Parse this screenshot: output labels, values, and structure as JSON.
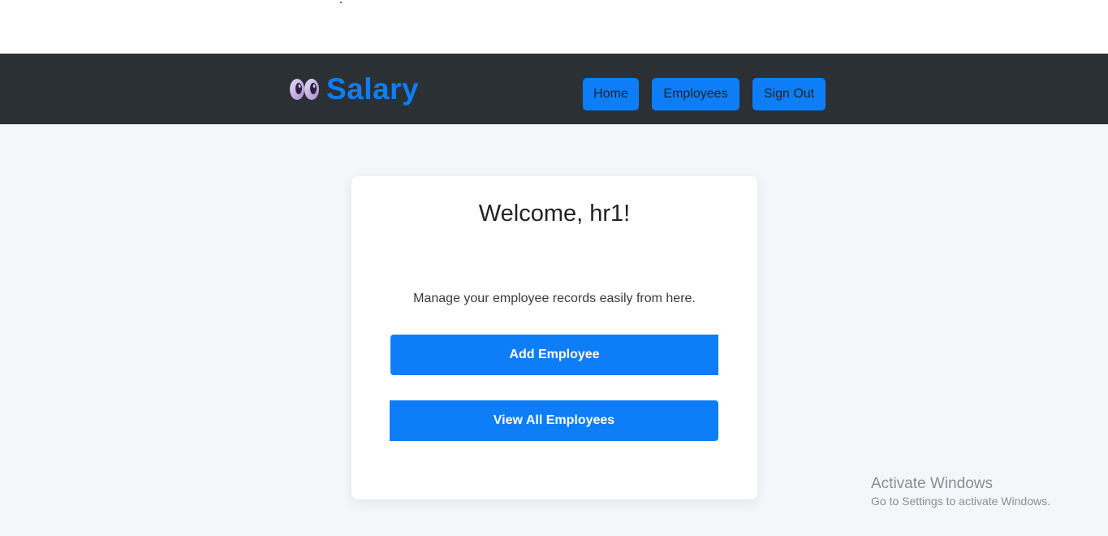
{
  "brand": {
    "name": "Salary",
    "logo_icon": "owl-eyes-icon",
    "color": "#0d7ef7"
  },
  "nav": {
    "home_label": "Home",
    "employees_label": "Employees",
    "signout_label": "Sign Out"
  },
  "card": {
    "welcome": "Welcome, hr1!",
    "subtitle": "Manage your employee records easily from here.",
    "add_label": "Add Employee",
    "view_label": "View All Employees"
  },
  "watermark": {
    "title": "Activate Windows",
    "subtitle": "Go to Settings to activate Windows."
  },
  "colors": {
    "navbar_bg": "#2b3035",
    "accent": "#0d7ef7",
    "page_bg": "#f4f6fa"
  }
}
